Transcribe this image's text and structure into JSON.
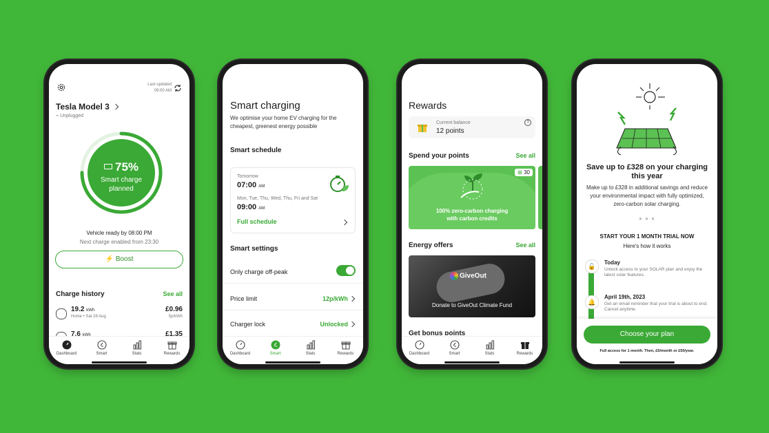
{
  "colors": {
    "background": "#41b739",
    "accent": "#3aa935",
    "accent_dark": "#2e8f2a"
  },
  "tabs": [
    "Dashboard",
    "Smart",
    "Stats",
    "Rewards"
  ],
  "dashboard": {
    "last_updated_label": "Last updated",
    "last_updated_time": "09:00 AM",
    "vehicle_name": "Tesla Model 3",
    "plug_status": "Unplugged",
    "charge_percent_text": "75%",
    "charge_percent_value": 75,
    "charge_status_line1": "Smart charge",
    "charge_status_line2": "planned",
    "ready_text": "Vehicle ready by 08:00 PM",
    "next_charge_text": "Next charge enabled from 23:30",
    "boost_label": "Boost",
    "history_title": "Charge history",
    "see_all": "See all",
    "history": [
      {
        "kwh": "19.2",
        "unit": "kWh",
        "detail": "Home • Sat 28 Aug",
        "price": "£0.96",
        "rate": "5p/kWh"
      },
      {
        "kwh": "7.6",
        "unit": "kWh",
        "detail": "",
        "price": "£1.35",
        "rate": ""
      }
    ]
  },
  "smart": {
    "title": "Smart charging",
    "subtitle": "We optimise your home EV charging for the cheapest, greenest energy possible",
    "schedule_title": "Smart schedule",
    "tomorrow_label": "Tomorrow",
    "tomorrow_time": "07:00",
    "tomorrow_ampm": "AM",
    "days_label": "Mon, Tue, Thu, Wed, Thu, Fri and Sat",
    "days_time": "09:00",
    "days_ampm": "AM",
    "full_schedule": "Full schedule",
    "settings_title": "Smart settings",
    "offpeak_label": "Only charge off-peak",
    "offpeak_on": true,
    "price_limit_label": "Price limit",
    "price_limit_value": "12p/kWh",
    "charger_lock_label": "Charger lock",
    "charger_lock_value": "Unlocked"
  },
  "rewards": {
    "title": "Rewards",
    "balance_label": "Current balance",
    "balance_value": "12 points",
    "spend_title": "Spend your points",
    "see_all": "See all",
    "offer_badge": "30",
    "offer_line1": "100% zero-carbon charging",
    "offer_line2": "with carbon credits",
    "energy_title": "Energy offers",
    "energy_see_all": "See all",
    "giveout_logo": "GiveOut",
    "giveout_caption": "Donate to GiveOut Climate Fund",
    "bonus_title": "Get bonus points"
  },
  "trial": {
    "headline": "Save up to £328 on your charging this year",
    "description": "Make up to £328 in additional savings and reduce your environmental impact with fully optimized, zero-carbon solar charging.",
    "start_title": "START YOUR 1 MONTH TRIAL NOW",
    "how_title": "Here's how it works",
    "step1_title": "Today",
    "step1_desc": "Unlock access to your SOLAR plan and enjoy the latest solar features.",
    "step2_title": "April 19th, 2023",
    "step2_desc": "Get an email reminder that your trial is about to end. Cancel anytime.",
    "cta": "Choose your plan",
    "fine_print": "Full access for 1 month. Then, £5/month or £50/year."
  }
}
